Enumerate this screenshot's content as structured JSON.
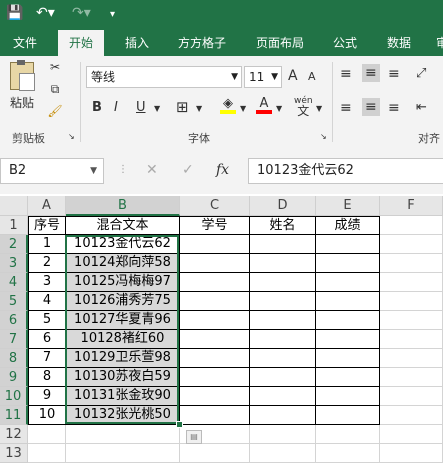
{
  "ribbon_tabs": [
    {
      "label": "文件"
    },
    {
      "label": "开始"
    },
    {
      "label": "插入"
    },
    {
      "label": "方方格子"
    },
    {
      "label": "页面布局"
    },
    {
      "label": "公式"
    },
    {
      "label": "数据"
    },
    {
      "label": "审"
    }
  ],
  "clipboard": {
    "paste": "粘贴",
    "group": "剪贴板"
  },
  "font": {
    "name": "等线",
    "size": "11",
    "group": "字体",
    "bold": "B",
    "italic": "I",
    "underline": "U",
    "grow": "A",
    "shrink": "A",
    "wen": "wén"
  },
  "align": {
    "group": "对齐"
  },
  "formula_bar": {
    "name_box": "B2",
    "cancel": "✕",
    "enter": "✓",
    "fx": "fx",
    "content": "10123金代云62"
  },
  "columns": [
    "A",
    "B",
    "C",
    "D",
    "E",
    "F"
  ],
  "row_numbers": [
    "1",
    "2",
    "3",
    "4",
    "5",
    "6",
    "7",
    "8",
    "9",
    "10",
    "11",
    "12",
    "13"
  ],
  "headers": [
    "序号",
    "混合文本",
    "学号",
    "姓名",
    "成绩"
  ],
  "rows": [
    [
      "1",
      "10123金代云62"
    ],
    [
      "2",
      "10124郑向萍58"
    ],
    [
      "3",
      "10125冯梅梅97"
    ],
    [
      "4",
      "10126浦秀芳75"
    ],
    [
      "5",
      "10127华夏青96"
    ],
    [
      "6",
      "10128褚红60"
    ],
    [
      "7",
      "10129卫乐萱98"
    ],
    [
      "8",
      "10130苏夜白59"
    ],
    [
      "9",
      "10131张金玫90"
    ],
    [
      "10",
      "10132张光桃50"
    ]
  ],
  "colors": {
    "brand": "#217346"
  }
}
